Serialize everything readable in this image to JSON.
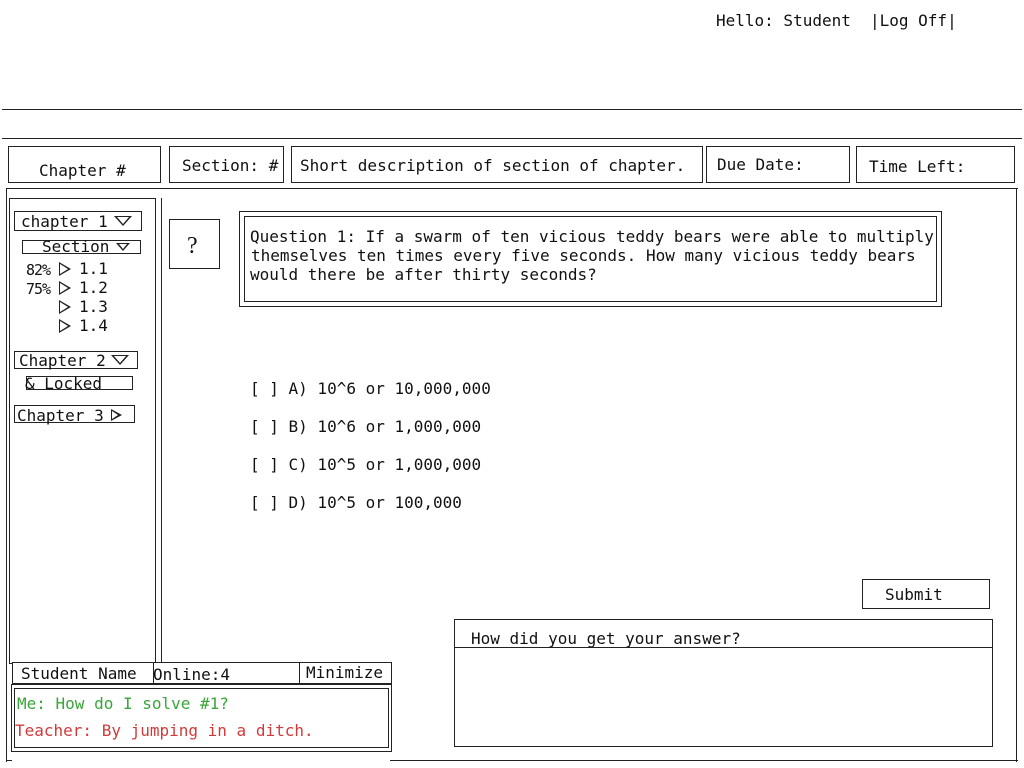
{
  "header": {
    "greeting": "Hello: Student",
    "logoff": "|Log Off|"
  },
  "infobar": {
    "chapter": "Chapter #",
    "section": "Section: #",
    "description": "Short description of section of chapter.",
    "due_date": "Due Date:",
    "time_left": "Time Left:"
  },
  "sidebar": {
    "chapter1": "chapter 1",
    "section_label": "Section",
    "subsections": [
      {
        "percent": "82%",
        "label": "1.1"
      },
      {
        "percent": "75%",
        "label": "1.2"
      },
      {
        "percent": "",
        "label": "1.3"
      },
      {
        "percent": "",
        "label": "1.4"
      }
    ],
    "chapter2": "Chapter 2",
    "locked": "& Locked",
    "chapter3": "Chapter 3"
  },
  "question": {
    "help": "?",
    "line1": "Question 1: If a swarm of ten vicious teddy bears were able to multiply",
    "line2": "themselves ten times every five seconds. How many vicious teddy bears",
    "line3": "would there be after thirty seconds?"
  },
  "answers": [
    "[ ] A) 10^6 or 10,000,000",
    "[ ] B) 10^6 or 1,000,000",
    "[ ] C) 10^5 or 1,000,000",
    "[ ] D) 10^5 or 100,000"
  ],
  "submit": "Submit",
  "explain": {
    "prompt": "How did you get your answer?",
    "value": ""
  },
  "chat": {
    "student_name": "Student Name",
    "online": "Online:4",
    "minimize": "Minimize",
    "messages": [
      {
        "text": "Me: How do I solve #1?",
        "color": "#3aa53a"
      },
      {
        "text": "Teacher: By jumping in a ditch.",
        "color": "#d23a3a"
      }
    ]
  }
}
